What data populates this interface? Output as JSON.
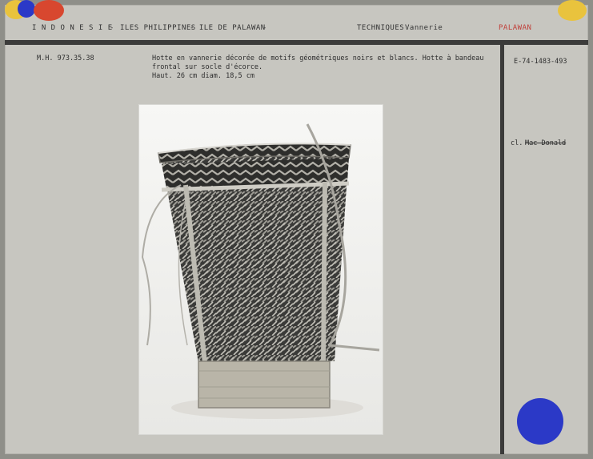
{
  "header": {
    "country": "I N D O N E S I E",
    "sep1": "-",
    "islands": "ILES PHILIPPINES",
    "sep2": "- ILE DE PALAWAN",
    "sep3": "-",
    "techniques_label": "TECHNIQUES",
    "technique": "Vannerie",
    "region": "PALAWAN"
  },
  "record": {
    "inventory": "M.H. 973.35.38",
    "description_lines": [
      "Hotte en vannerie décorée de motifs géométriques noirs et blancs. Hotte à bandeau",
      "frontal sur socle d'écorce.",
      "Haut. 26 cm  diam. 18,5 cm"
    ],
    "negative_number": "E-74-1483-493",
    "credit_prefix": "cl.",
    "credit_name": "Mac Donald"
  },
  "colors": {
    "yellow_dot": "#e9c33d",
    "red_dot": "#d8472f",
    "blue_dot": "#2b39c7",
    "region_text": "#c0403a"
  }
}
